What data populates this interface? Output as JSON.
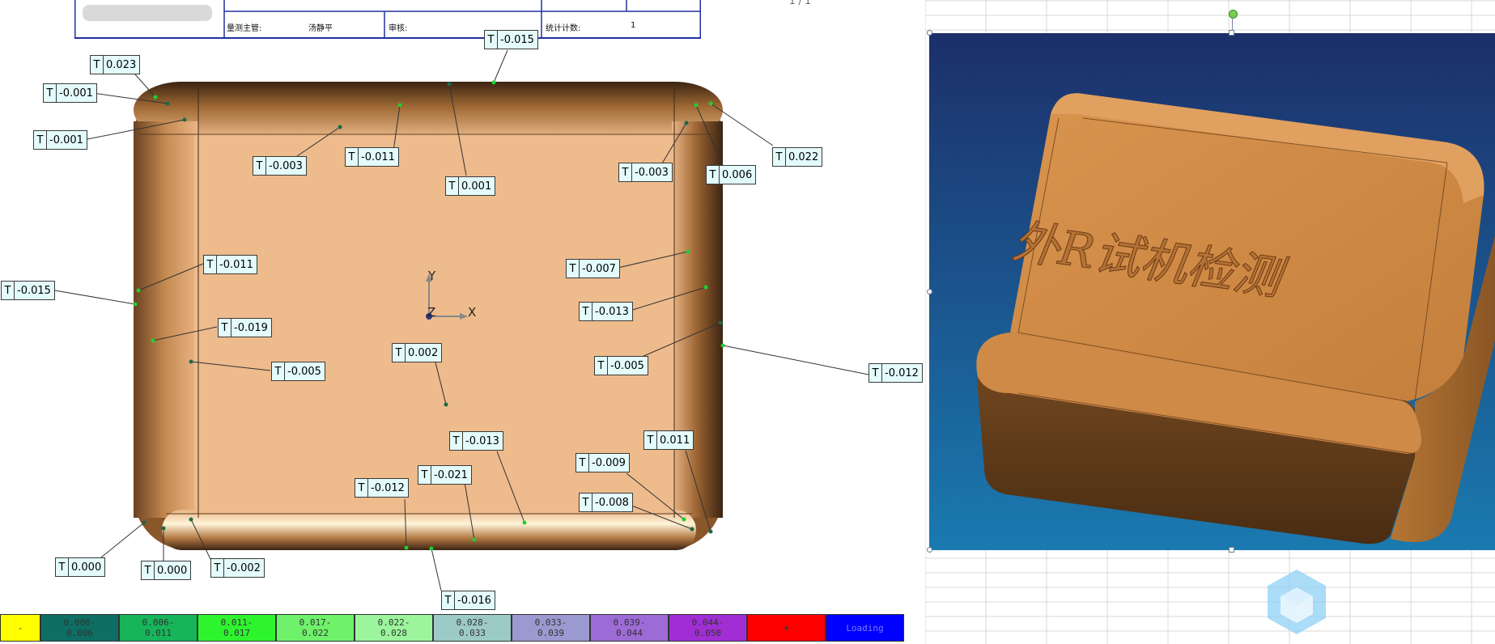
{
  "report": {
    "manager_label": "量测主管:",
    "manager_name": "汤静平",
    "reviewer_label": "审核:",
    "count_label": "统计计数:",
    "count_value": "1",
    "page_indicator": "1 / 1"
  },
  "labels": [
    {
      "t": "T",
      "v": "0.023"
    },
    {
      "t": "T",
      "v": "-0.001"
    },
    {
      "t": "T",
      "v": "-0.001"
    },
    {
      "t": "T",
      "v": "-0.015"
    },
    {
      "t": "T",
      "v": "-0.003"
    },
    {
      "t": "T",
      "v": "-0.011"
    },
    {
      "t": "T",
      "v": "0.001"
    },
    {
      "t": "T",
      "v": "-0.003"
    },
    {
      "t": "T",
      "v": "0.006"
    },
    {
      "t": "T",
      "v": "0.022"
    },
    {
      "t": "T",
      "v": "-0.011"
    },
    {
      "t": "T",
      "v": "-0.015"
    },
    {
      "t": "T",
      "v": "-0.019"
    },
    {
      "t": "T",
      "v": "-0.005"
    },
    {
      "t": "T",
      "v": "0.002"
    },
    {
      "t": "T",
      "v": "-0.007"
    },
    {
      "t": "T",
      "v": "-0.013"
    },
    {
      "t": "T",
      "v": "-0.005"
    },
    {
      "t": "T",
      "v": "-0.012"
    },
    {
      "t": "T",
      "v": "-0.013"
    },
    {
      "t": "T",
      "v": "0.011"
    },
    {
      "t": "T",
      "v": "-0.009"
    },
    {
      "t": "T",
      "v": "-0.021"
    },
    {
      "t": "T",
      "v": "-0.012"
    },
    {
      "t": "T",
      "v": "-0.008"
    },
    {
      "t": "T",
      "v": "0.000"
    },
    {
      "t": "T",
      "v": "0.000"
    },
    {
      "t": "T",
      "v": "-0.002"
    },
    {
      "t": "T",
      "v": "-0.016"
    }
  ],
  "axes": {
    "x": "X",
    "y": "Y",
    "z": "Z"
  },
  "scale": [
    {
      "label": "-",
      "color": "#ffff00"
    },
    {
      "label": "0.000-\n0.006",
      "color": "#0e6e63"
    },
    {
      "label": "0.006-\n0.011",
      "color": "#17b55a"
    },
    {
      "label": "0.011-\n0.017",
      "color": "#2ef42e"
    },
    {
      "label": "0.017-\n0.022",
      "color": "#6ff26a"
    },
    {
      "label": "0.022-\n0.028",
      "color": "#9cf59c"
    },
    {
      "label": "0.028-\n0.033",
      "color": "#9ccac7"
    },
    {
      "label": "0.033-\n0.039",
      "color": "#9a9ad0"
    },
    {
      "label": "0.039-\n0.044",
      "color": "#9d6bd6"
    },
    {
      "label": "0.044-\n0.050",
      "color": "#a02ed4"
    },
    {
      "label": "+",
      "color": "#ff0000"
    },
    {
      "label": "Loading",
      "color": "#0000ff"
    }
  ],
  "render_title": "外R试机检测",
  "colors": {
    "part": "#d48b45",
    "bg_top": "#1c2f6a",
    "bg_bottom": "#1a7ab0",
    "label_bg": "#e4fbfb"
  }
}
